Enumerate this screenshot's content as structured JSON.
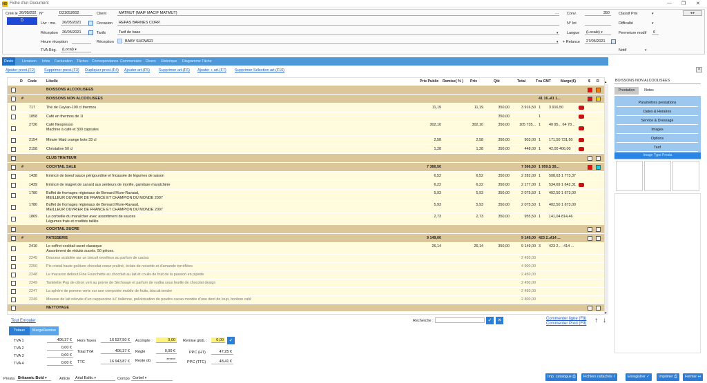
{
  "window": {
    "title": "Fiche d'un Document",
    "app_icon": "HD"
  },
  "header": {
    "cree_le_label": "Créé le",
    "cree_le": "26/05/202",
    "numero_label": "N°",
    "numero": "D21052602",
    "d_badge": "D",
    "livraison_label": "Livr : me.",
    "livraison": "26/05/2021",
    "reception_label": "Réception",
    "reception_date": "26/05/2021",
    "heure_reception_label": "Heure réception",
    "tva_reg_label": "TVA Rég.",
    "tva_reg": "(Local)",
    "client_label": "Client",
    "client": "MATMUT (MAIF MACIF MATMUT)",
    "occasion_label": "Occasion",
    "occasion": "REPAS BARNES CORP.",
    "tarifs_label": "Tarifs",
    "tarifs": "Tarif de base",
    "reception_label2": "Réception",
    "reception_value": "BABY SHOWER",
    "conv_label": "Conv.",
    "conv": "350",
    "n_int_label": "N° Int",
    "langue_label": "Langue",
    "langue": "(Locale)",
    "relance_label": "+ Relance",
    "relance": "27/05/2021",
    "classif_label": "Classif Prix",
    "difficulte_label": "Difficulté",
    "fermeture_label": "Fermeture modif",
    "fermeture_value": "0",
    "notif_label": "Notif"
  },
  "tabs": [
    "Devis",
    "Livraison",
    "Infos",
    "Facturation",
    "Tâches",
    "Correspondance",
    "Commentaire",
    "Divers",
    "Historique",
    "Diagramme Tâche"
  ],
  "actions": [
    "Ajouter prest.(F2)",
    "Supprimer prest.(F3)",
    "Dupliquer prest.(F4)",
    "Ajouter art.(F5)",
    "Supprimer art.(F6)",
    "Ajouter + art.(F7)",
    "Supprimer Sélection art.(F10)"
  ],
  "grid": {
    "headers": {
      "d": "D",
      "code": "Code",
      "libelle": "Libellé",
      "prix_public": "Prix Public",
      "remise": "Remise( % )",
      "prix": "Prix",
      "qte": "Qté",
      "total": "Total",
      "tva_cmt": "Tva CMT",
      "marge": "Marge(€)",
      "s": "$",
      "d2": "D"
    },
    "rows": [
      {
        "type": "section",
        "libelle": "BOISSONS ALCOOLISEES",
        "marge": "",
        "h": 12,
        "sq": [
          "red",
          "orange"
        ]
      },
      {
        "type": "section",
        "libelle": "BOISSONS NON ALCOOLISEES",
        "hash": "#",
        "total": "",
        "tva": "41 16...",
        "marge": "-41 1...",
        "h": 12,
        "sq": [
          "red",
          "yellow"
        ]
      },
      {
        "type": "line",
        "code": "717",
        "libelle": "Thé de Ceylan-100 cl thermos",
        "pp": "11,19",
        "prix": "11,19",
        "qte": "350,00",
        "total": "3 916,50",
        "tva": "1",
        "marge": "3 916,50",
        "h": 12,
        "car": true
      },
      {
        "type": "line",
        "code": "1858",
        "libelle": "Café en thermos de 1l",
        "pp": "",
        "prix": "",
        "qte": "350,00",
        "total": "",
        "tva": "1",
        "marge": "",
        "h": 12,
        "car": true
      },
      {
        "type": "line",
        "code": "2726",
        "libelle": "Café Nespresso",
        "libelle2": "Machine à café et 300 capsules",
        "pp": "302,10",
        "prix": "302,10",
        "qte": "350,00",
        "total": "105 735...",
        "tva": "1",
        "marge": "40 95...  64 78...",
        "h": 20,
        "car": true
      },
      {
        "type": "line",
        "code": "2154",
        "libelle": "Minute Maid orange bote 33 cl",
        "pp": "2,58",
        "prix": "2,58",
        "qte": "350,00",
        "total": "903,00",
        "tva": "1",
        "marge": "171,50   731,50",
        "h": 12,
        "car": true
      },
      {
        "type": "line",
        "code": "2158",
        "libelle": "Christaline 50 cl",
        "pp": "1,28",
        "prix": "1,28",
        "qte": "350,00",
        "total": "448,00",
        "tva": "1",
        "marge": "42,00   406,00",
        "h": 12,
        "car": true
      },
      {
        "type": "section",
        "libelle": "CLUB TRAITEUR",
        "h": 12,
        "sq": [
          "white",
          "white"
        ]
      },
      {
        "type": "section",
        "libelle": "COCKTAIL SALE",
        "hash": "#",
        "pp": "7 366,50",
        "total": "7 366,50",
        "tva": "1 959...",
        "marge": "5 39...",
        "h": 12,
        "sq": [
          "red",
          "cyan"
        ]
      },
      {
        "type": "line",
        "code": "1438",
        "libelle": "Emincé de boeuf sauce périgourdine  et fricassée de légumes de saison",
        "pp": "6,52",
        "prix": "6,52",
        "qte": "350,00",
        "total": "2 282,00",
        "tva": "1",
        "marge": "508,63  1 773,37",
        "h": 12
      },
      {
        "type": "line",
        "code": "1439",
        "libelle": "Emincé de magret de canard aux senteurs de morille, garniture maraîchère",
        "pp": "6,22",
        "prix": "6,22",
        "qte": "350,00",
        "total": "2 177,00",
        "tva": "1",
        "marge": "534,69  1 642,31",
        "h": 12,
        "car": true
      },
      {
        "type": "line",
        "code": "1780",
        "libelle": "Buffet de fromages régionaux de Bernard Mure-Ravaud,",
        "libelle2": "MEILLEUR OUVRIER DE FRANCE ET CHAMPION DU MONDE 2007",
        "pp": "5,93",
        "prix": "5,93",
        "qte": "350,00",
        "total": "2 075,50",
        "tva": "1",
        "marge": "402,50  1 673,00",
        "h": 16
      },
      {
        "type": "line",
        "code": "1780",
        "libelle": "Buffet de fromages régionaux de Bernard Mure-Ravaud,",
        "libelle2": "MEILLEUR OUVRIER DE FRANCE ET CHAMPION DU MONDE 2007",
        "pp": "5,93",
        "prix": "5,93",
        "qte": "350,00",
        "total": "2 075,50",
        "tva": "1",
        "marge": "402,50  1 673,00",
        "h": 16
      },
      {
        "type": "line",
        "code": "1869",
        "libelle": "La corbeille du maraîcher avec assortiment de sauces",
        "libelle2": "Légumes frais et crudités taillés",
        "pp": "2,73",
        "prix": "2,73",
        "qte": "350,00",
        "total": "955,50",
        "tva": "1",
        "marge": "141,04   814,46",
        "h": 16
      },
      {
        "type": "section",
        "libelle": "COCKTAIL SUCRE",
        "h": 12,
        "sq": [
          "white",
          "white"
        ]
      },
      {
        "type": "section",
        "libelle": "PATISSERIE",
        "hash": "#",
        "pp": "9 149,00",
        "total": "9 149,00",
        "tva": "423 2...",
        "marge": "-414 ...",
        "h": 12,
        "sq": [
          "white",
          "white"
        ]
      },
      {
        "type": "line",
        "code": "2416",
        "libelle": "Le coffret cocktail sucré classique",
        "libelle2": "Assortiment de réduits sucrés. 50 pièces.",
        "pp": "26,14",
        "prix": "26,14",
        "qte": "350,00",
        "total": "9 149,00",
        "tva": "3",
        "marge": "423 2...  -414 ...",
        "h": 16
      },
      {
        "type": "light",
        "code": "2245",
        "libelle": "Douceur acidulée sur un biscuit moelleux au parfum de cactus",
        "total": "2 450,00",
        "h": 11
      },
      {
        "type": "light",
        "code": "2250",
        "libelle": "Pic cristal haute goûture chocolat coeur praliné, éclats de noisette et d'amande torréfiées",
        "total": "4 900,00",
        "h": 11
      },
      {
        "type": "light",
        "code": "2248",
        "libelle": "Le macaron debout Fine Fourchette au chocolat au lait et coulis de fruit de la passion en pipette",
        "total": "2 450,00",
        "h": 11
      },
      {
        "type": "light",
        "code": "2249",
        "libelle": "Tartelette Pop de citron vert au poivre de Séchouan et parfum de vodka sous feuille de chocolat design",
        "total": "2 450,00",
        "h": 11
      },
      {
        "type": "light",
        "code": "2247",
        "libelle": "La sphère de pomme verte sur une compotée mobile de fruits, biscuit tendre",
        "total": "2 450,00",
        "h": 11
      },
      {
        "type": "light",
        "code": "2249",
        "libelle": "Mousse de lait relevée d'un cappuccino à l' italienne, pulvérisation de poudre cacao montée d'une dent de loup, bonbon café",
        "total": "2 800,00",
        "h": 11
      },
      {
        "type": "section",
        "libelle": "NETTOYAGE",
        "h": 10,
        "sq": [
          "white",
          "white"
        ]
      }
    ]
  },
  "right_panel": {
    "title": "BOISSONS NON ALCOOLISEES",
    "tabs": [
      "Prestation",
      "Notes"
    ],
    "buttons": [
      "Paramètres prestations",
      "Dates & Horaires",
      "Service & Dressage",
      "Images",
      "Options",
      "Tarif"
    ],
    "image_type": "Image Type Presta"
  },
  "bottom": {
    "tout_enrouler": "Tout Enrouler",
    "recherche_label": "Recherche :",
    "commenter_ligne": "Commenter ligne (F8)",
    "commenter_prod": "Commenter Prod (F9)",
    "tabs": [
      "Totaux",
      "MargeRemise"
    ],
    "tva": [
      {
        "label": "TVA 1",
        "value": "406,37 €"
      },
      {
        "label": "TVA 2",
        "value": "0,00 €"
      },
      {
        "label": "TVA 3",
        "value": "0,00 €"
      },
      {
        "label": "TVA 4",
        "value": "0,00 €"
      }
    ],
    "hors_taxes_label": "Hors Taxes",
    "hors_taxes": "16 537,50 €",
    "total_tva_label": "Total TVA",
    "total_tva": "406,37 €",
    "ttc_label": "TTC",
    "ttc": "16 943,87 €",
    "acompte_label": "Acompte :",
    "acompte": "0,00",
    "regle_label": "Réglé",
    "regle": "0,00 €",
    "reste_label": "Reste dû",
    "reste": "******",
    "remise_label": "Remise glob. :",
    "remise": "0,00",
    "ppc_ht_label": "PPC (HT)",
    "ppc_ht": "47,25 €",
    "ppc_ttc_label": "PPC (TTC)",
    "ppc_ttc": "48,41 €",
    "presta_label": "Presta",
    "presta_font": "Britannic Bold",
    "article_label": "Article",
    "article_font": "Arial Baltic",
    "compo_label": "Compo",
    "compo_font": "Corbel",
    "footer_buttons": [
      "Imp. catalogue",
      "Fichiers rattachés",
      "Enregistrer",
      "Imprimer",
      "Fermer"
    ]
  }
}
